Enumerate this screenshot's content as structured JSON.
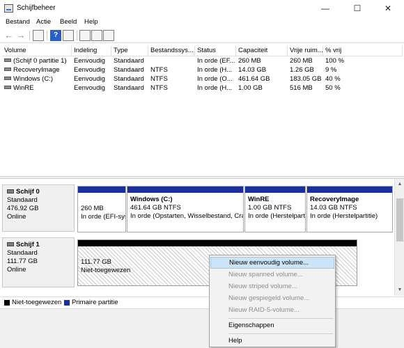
{
  "window": {
    "title": "Schijfbeheer",
    "controls": [
      "—",
      "☐",
      "✕"
    ]
  },
  "menu": [
    "Bestand",
    "Actie",
    "Beeld",
    "Help"
  ],
  "table": {
    "columns": [
      "Volume",
      "Indeling",
      "Type",
      "Bestandssys...",
      "Status",
      "Capaciteit",
      "Vrije ruim...",
      "% vrij"
    ],
    "rows": [
      [
        "(Schijf 0 partitie 1)",
        "Eenvoudig",
        "Standaard",
        "",
        "In orde (EF...",
        "260 MB",
        "260 MB",
        "100 %"
      ],
      [
        "RecoveryImage",
        "Eenvoudig",
        "Standaard",
        "NTFS",
        "In orde (H...",
        "14.03 GB",
        "1.26 GB",
        "9 %"
      ],
      [
        "Windows (C:)",
        "Eenvoudig",
        "Standaard",
        "NTFS",
        "In orde (O...",
        "461.64 GB",
        "183.05 GB",
        "40 %"
      ],
      [
        "WinRE",
        "Eenvoudig",
        "Standaard",
        "NTFS",
        "In orde (H...",
        "1.00 GB",
        "516 MB",
        "50 %"
      ]
    ]
  },
  "disks": [
    {
      "name": "Schijf 0",
      "type": "Standaard",
      "size": "476.92 GB",
      "state": "Online",
      "partitions": [
        {
          "name": "",
          "line1": "260 MB",
          "line2": "In orde (EFI-sys"
        },
        {
          "name": "Windows  (C:)",
          "line1": "461.64 GB NTFS",
          "line2": "In orde (Opstarten, Wisselbestand, Cras"
        },
        {
          "name": "WinRE",
          "line1": "1.00 GB NTFS",
          "line2": "In orde (Herstelpart"
        },
        {
          "name": "RecoveryImage",
          "line1": "14.03 GB NTFS",
          "line2": "In orde (Herstelpartitie)"
        }
      ]
    },
    {
      "name": "Schijf 1",
      "type": "Standaard",
      "size": "111.77 GB",
      "state": "Online",
      "partitions": [
        {
          "line1": "111.77 GB",
          "line2": "Niet-toegewezen"
        }
      ]
    }
  ],
  "legend": {
    "unallocated": "Niet-toegewezen",
    "primary": "Primaire partitie"
  },
  "context_menu": [
    {
      "label": "Nieuw eenvoudig volume...",
      "enabled": true,
      "highlighted": true
    },
    {
      "label": "Nieuw spanned volume...",
      "enabled": false
    },
    {
      "label": "Nieuw striped volume...",
      "enabled": false
    },
    {
      "label": "Nieuw gespiegeld volume...",
      "enabled": false
    },
    {
      "label": "Nieuw RAID-5-volume...",
      "enabled": false
    },
    {
      "label": "Eigenschappen",
      "enabled": true
    },
    {
      "label": "Help",
      "enabled": true
    }
  ],
  "colors": {
    "primary_partition": "#1b2f9e",
    "unallocated": "#000000",
    "menu_highlight": "#cce4f7"
  }
}
